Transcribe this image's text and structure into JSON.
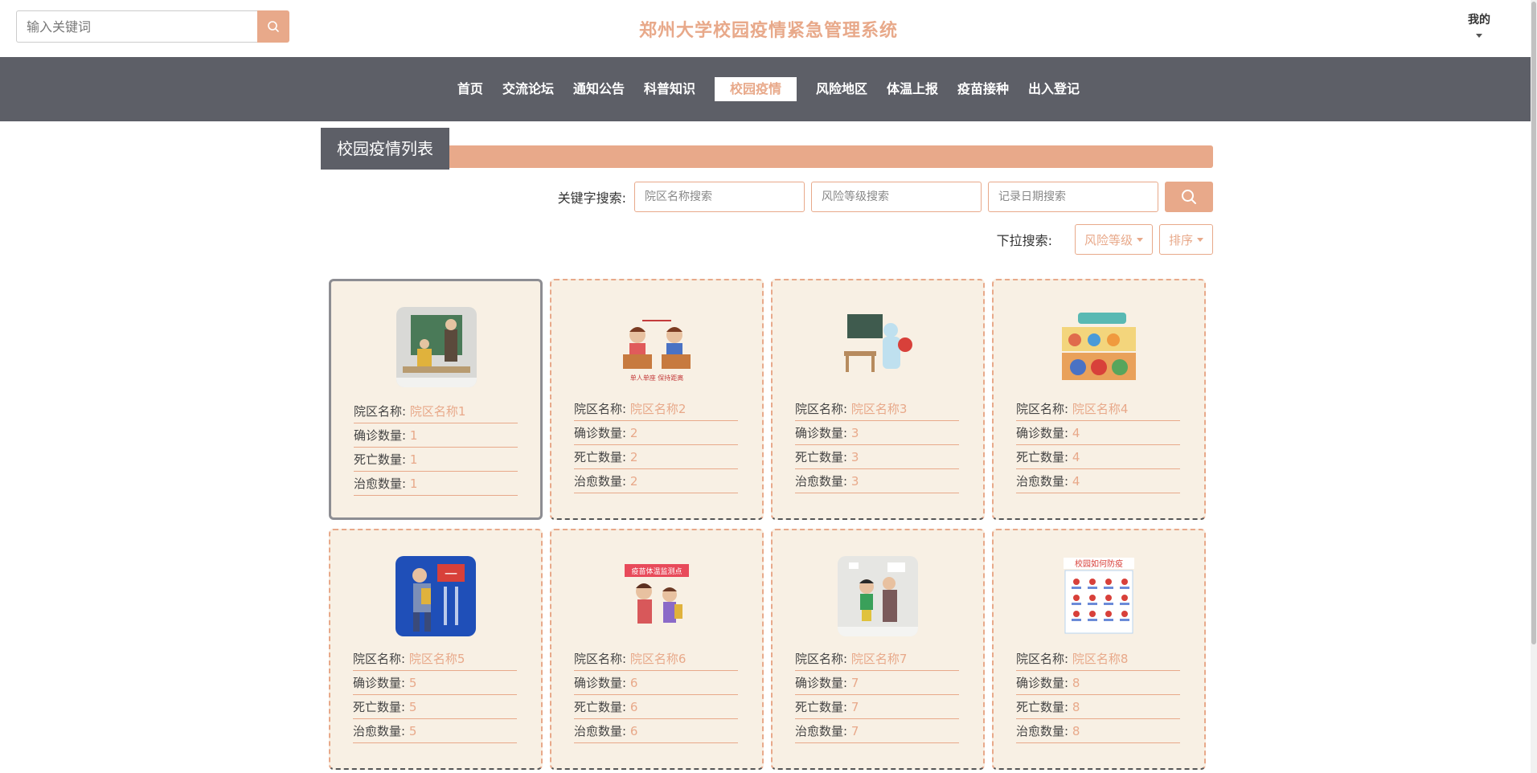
{
  "header": {
    "search_placeholder": "输入关键词",
    "site_title": "郑州大学校园疫情紧急管理系统",
    "my_label": "我的"
  },
  "nav": {
    "items": [
      "首页",
      "交流论坛",
      "通知公告",
      "科普知识",
      "校园疫情",
      "风险地区",
      "体温上报",
      "疫苗接种",
      "出入登记"
    ],
    "active_index": 4
  },
  "section": {
    "title": "校园疫情列表"
  },
  "filters": {
    "keyword_label": "关键字搜索:",
    "campus_placeholder": "院区名称搜索",
    "risk_placeholder": "风险等级搜索",
    "date_placeholder": "记录日期搜索",
    "dropdown_label": "下拉搜索:",
    "risk_dropdown": "风险等级",
    "sort_dropdown": "排序"
  },
  "labels": {
    "campus": "院区名称",
    "confirmed": "确诊数量",
    "deaths": "死亡数量",
    "recovered": "治愈数量"
  },
  "cards": [
    {
      "campus": "院区名称1",
      "confirmed": "1",
      "deaths": "1",
      "recovered": "1",
      "image": "classroom-illustration"
    },
    {
      "campus": "院区名称2",
      "confirmed": "2",
      "deaths": "2",
      "recovered": "2",
      "image": "distancing-desks-illustration",
      "caption": "单人单座 保持距离"
    },
    {
      "campus": "院区名称3",
      "confirmed": "3",
      "deaths": "3",
      "recovered": "3",
      "image": "disinfection-illustration"
    },
    {
      "campus": "院区名称4",
      "confirmed": "4",
      "deaths": "4",
      "recovered": "4",
      "image": "prevention-poster"
    },
    {
      "campus": "院区名称5",
      "confirmed": "5",
      "deaths": "5",
      "recovered": "5",
      "image": "campus-gate-poster"
    },
    {
      "campus": "院区名称6",
      "confirmed": "6",
      "deaths": "6",
      "recovered": "6",
      "image": "temperature-check-illustration",
      "caption": "疫苗体温监测点"
    },
    {
      "campus": "院区名称7",
      "confirmed": "7",
      "deaths": "7",
      "recovered": "7",
      "image": "school-entry-illustration"
    },
    {
      "campus": "院区名称8",
      "confirmed": "8",
      "deaths": "8",
      "recovered": "8",
      "image": "campus-prevention-poster",
      "caption": "校园如何防疫"
    }
  ],
  "selected_card": 0,
  "colors": {
    "accent": "#e8a98a",
    "nav_bg": "#5d5f67",
    "card_bg": "#f8f0e4"
  }
}
